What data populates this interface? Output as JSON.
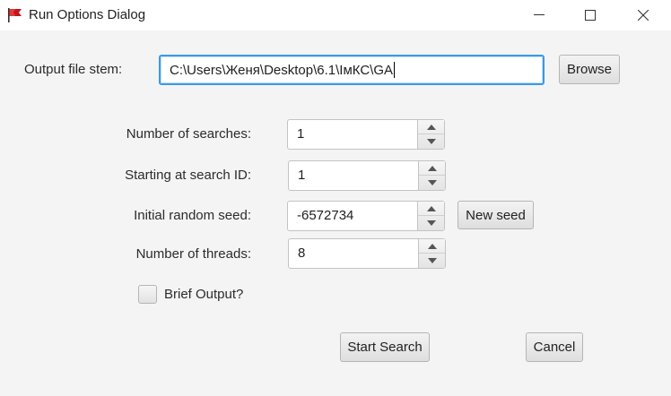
{
  "window": {
    "title": "Run Options Dialog",
    "icon": "red-flag-icon",
    "controls": [
      "minimize-icon",
      "maximize-icon",
      "close-icon"
    ]
  },
  "output": {
    "label": "Output file stem:",
    "value": "C:\\Users\\Женя\\Desktop\\6.1\\ІмКС\\GA",
    "browse_label": "Browse"
  },
  "fields": {
    "searches": {
      "label": "Number of searches:",
      "value": "1"
    },
    "start_id": {
      "label": "Starting at search ID:",
      "value": "1"
    },
    "seed": {
      "label": "Initial random seed:",
      "value": "-6572734",
      "new_seed_label": "New seed"
    },
    "threads": {
      "label": "Number of threads:",
      "value": "8"
    }
  },
  "brief_output": {
    "label": "Brief Output?",
    "checked": false
  },
  "actions": {
    "start_label": "Start Search",
    "cancel_label": "Cancel"
  },
  "colors": {
    "focus_border": "#3d9ae0",
    "background": "#f4f4f4"
  }
}
